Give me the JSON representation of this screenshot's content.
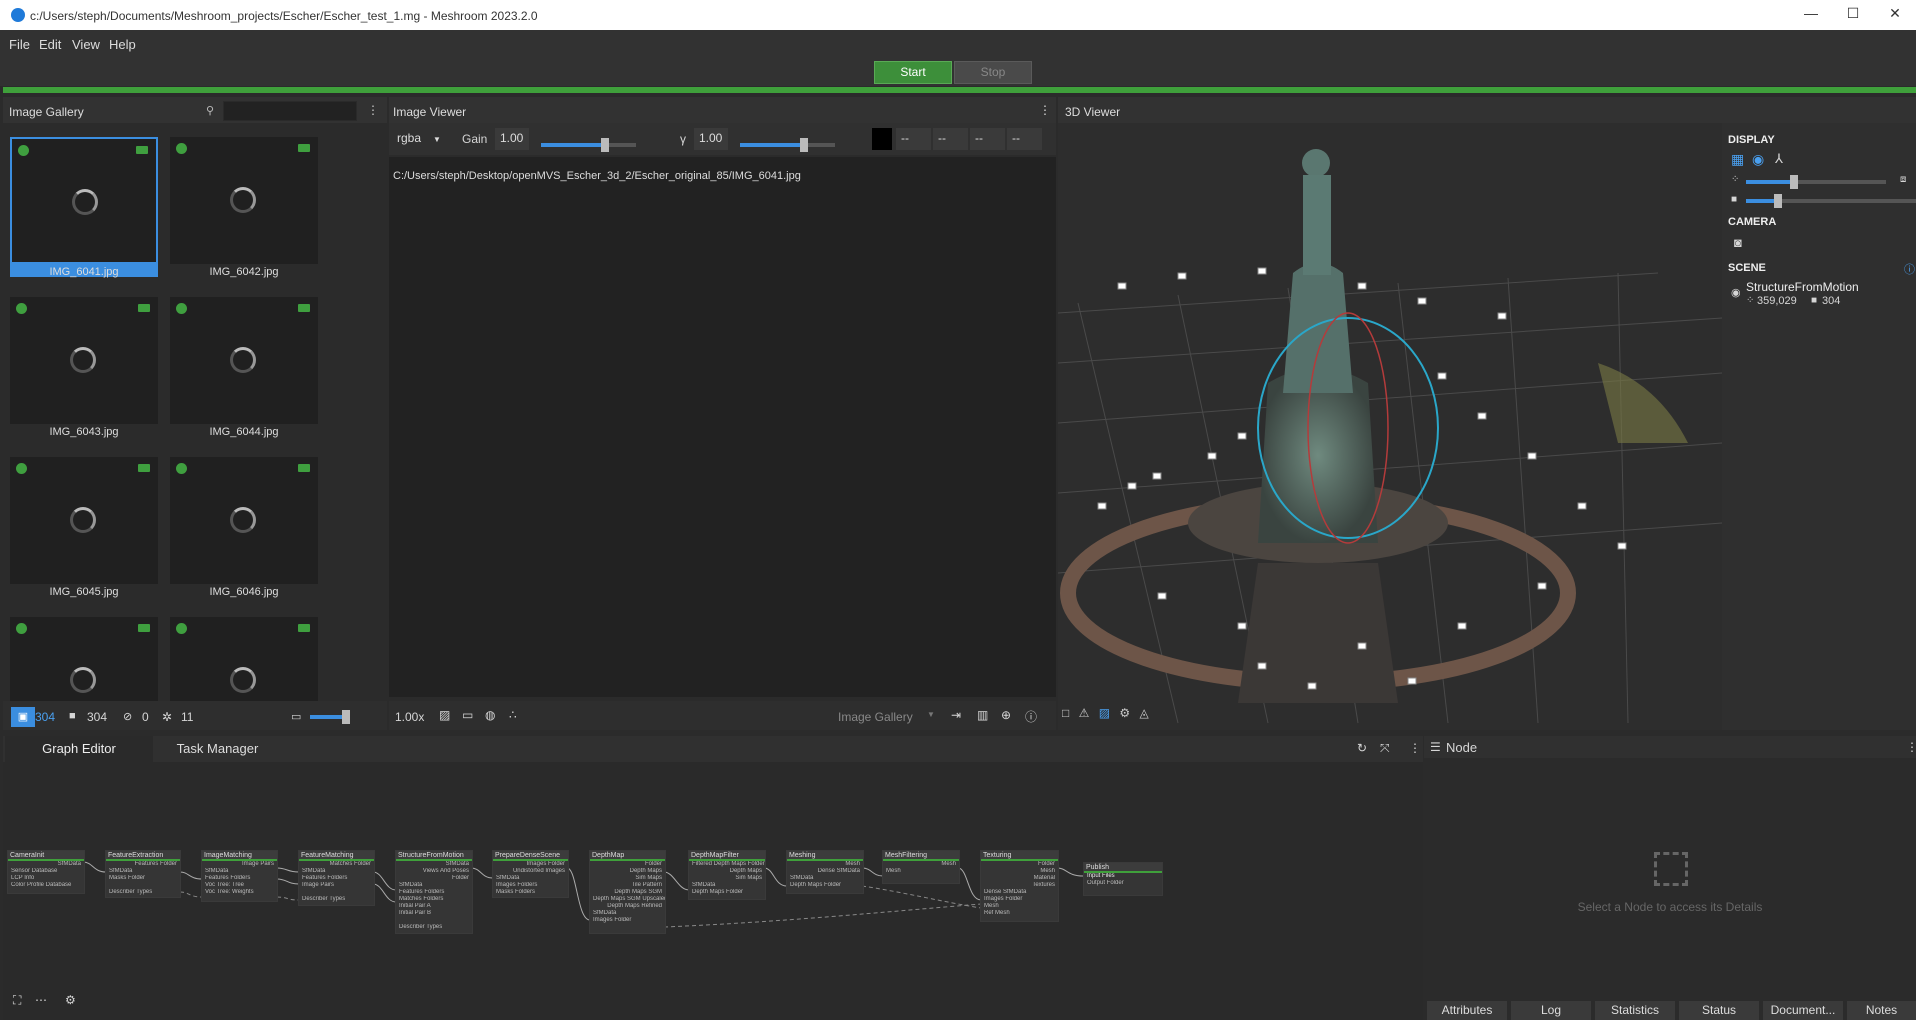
{
  "window": {
    "title": "c:/Users/steph/Documents/Meshroom_projects/Escher/Escher_test_1.mg - Meshroom 2023.2.0",
    "min": "—",
    "max": "☐",
    "close": "✕"
  },
  "menu": {
    "file": "File",
    "edit": "Edit",
    "view": "View",
    "help": "Help"
  },
  "toolbar": {
    "start": "Start",
    "stop": "Stop"
  },
  "gallery": {
    "title": "Image Gallery",
    "search_placeholder": "",
    "images": [
      "IMG_6041.jpg",
      "IMG_6042.jpg",
      "IMG_6043.jpg",
      "IMG_6044.jpg",
      "IMG_6045.jpg",
      "IMG_6046.jpg",
      "",
      ""
    ],
    "footer": {
      "images": "304",
      "cameras": "304",
      "no_cameras": "0",
      "intrinsics": "11"
    }
  },
  "viewer": {
    "title": "Image Viewer",
    "channel": "rgba",
    "gain_label": "Gain",
    "gain": "1.00",
    "gamma_label": "γ",
    "gamma": "1.00",
    "pixel_values": [
      "--",
      "--",
      "--",
      "--"
    ],
    "path": "C:/Users/steph/Desktop/openMVS_Escher_3d_2/Escher_original_85/IMG_6041.jpg",
    "zoom": "1.00x",
    "source": "Image Gallery"
  },
  "viewer3d": {
    "title": "3D Viewer",
    "display": "DISPLAY",
    "camera": "CAMERA",
    "scene": "SCENE",
    "scene_item": {
      "name": "StructureFromMotion",
      "points": "359,029",
      "cameras": "304"
    }
  },
  "tabs": {
    "graph": "Graph Editor",
    "tasks": "Task Manager"
  },
  "graph": {
    "nodes": [
      {
        "name": "CameraInit",
        "ports": [
          "Sensor Database",
          "LCP Info",
          "Color Profile Database"
        ],
        "outs": [
          "SfMData"
        ]
      },
      {
        "name": "FeatureExtraction",
        "ports": [
          "SfMData",
          "Masks Folder",
          "",
          "Describer Types"
        ],
        "outs": [
          "Features Folder"
        ]
      },
      {
        "name": "ImageMatching",
        "ports": [
          "SfMData",
          "Features Folders",
          "Voc Tree: Tree",
          "Voc Tree: Weights"
        ],
        "outs": [
          "Image Pairs"
        ]
      },
      {
        "name": "FeatureMatching",
        "ports": [
          "SfMData",
          "Features Folders",
          "Image Pairs",
          "",
          "Describer Types"
        ],
        "outs": [
          "Matches Folder"
        ]
      },
      {
        "name": "StructureFromMotion",
        "ports": [
          "SfMData",
          "Features Folders",
          "Matches Folders",
          "Initial Pair A",
          "Initial Pair B",
          "",
          "Describer Types"
        ],
        "outs": [
          "SfMData",
          "Views And Poses",
          "Folder"
        ]
      },
      {
        "name": "PrepareDenseScene",
        "ports": [
          "SfMData",
          "Images Folders",
          "Masks Folders"
        ],
        "outs": [
          "Images Folder",
          "Undistorted Images"
        ]
      },
      {
        "name": "DepthMap",
        "ports": [
          "SfMData",
          "Images Folder"
        ],
        "outs": [
          "Folder",
          "Depth Maps",
          "Sim Maps",
          "Tile Pattern",
          "Depth Maps SGM",
          "Depth Maps SGM Upscaled",
          "Depth Maps Refined"
        ]
      },
      {
        "name": "DepthMapFilter",
        "ports": [
          "SfMData",
          "Depth Maps Folder"
        ],
        "outs": [
          "Filtered Depth Maps Folder",
          "Depth Maps",
          "Sim Maps"
        ]
      },
      {
        "name": "Meshing",
        "ports": [
          "SfMData",
          "Depth Maps Folder"
        ],
        "outs": [
          "Mesh",
          "Dense SfMData"
        ]
      },
      {
        "name": "MeshFiltering",
        "ports": [
          "Mesh"
        ],
        "outs": [
          "Mesh"
        ]
      },
      {
        "name": "Texturing",
        "ports": [
          "Dense SfMData",
          "Images Folder",
          "Mesh",
          "Ref Mesh"
        ],
        "outs": [
          "Folder",
          "Mesh",
          "Material",
          "Textures"
        ]
      },
      {
        "name": "Publish",
        "ports": [
          "Input Files",
          "Output Folder"
        ],
        "outs": []
      }
    ]
  },
  "node_panel": {
    "title": "Node",
    "empty": "Select a Node to access its Details",
    "tabs": [
      "Attributes",
      "Log",
      "Statistics",
      "Status",
      "Document...",
      "Notes"
    ]
  },
  "colors": {
    "accent": "#3b8ee0",
    "progress": "#3fa03b",
    "start": "#3d8f3a"
  }
}
